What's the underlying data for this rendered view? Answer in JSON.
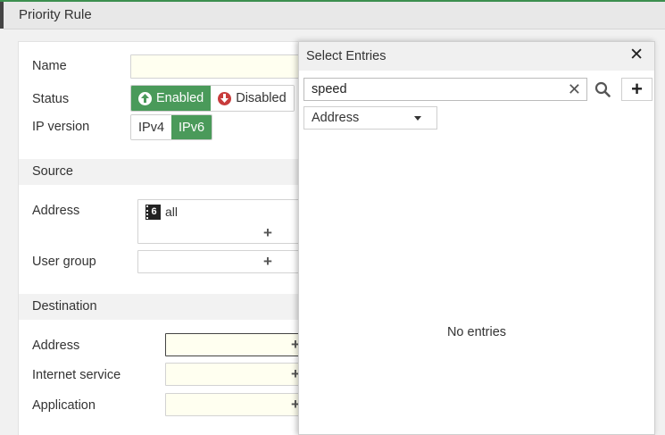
{
  "header": {
    "title": "Priority Rule"
  },
  "form": {
    "name_label": "Name",
    "name_value": "",
    "status_label": "Status",
    "status_options": [
      "Enabled",
      "Disabled"
    ],
    "status_selected": "Enabled",
    "ip_version_label": "IP version",
    "ip_options": [
      "IPv4",
      "IPv6"
    ],
    "ip_selected": "IPv6",
    "source": {
      "section_title": "Source",
      "address_label": "Address",
      "address_items": [
        "all"
      ],
      "user_group_label": "User group"
    },
    "destination": {
      "section_title": "Destination",
      "address_label": "Address",
      "internet_service_label": "Internet service",
      "application_label": "Application"
    },
    "add_symbol": "+"
  },
  "panel": {
    "title": "Select Entries",
    "close_symbol": "✕",
    "search_value": "speed",
    "clear_symbol": "✕",
    "add_symbol": "+",
    "filter_selected": "Address",
    "empty_text": "No entries"
  },
  "colors": {
    "accent_green": "#4a9a5a",
    "disabled_red": "#c83c3c",
    "input_bg": "#fffff0"
  },
  "icons": {
    "enabled": "arrow-up-circle-icon",
    "disabled": "arrow-down-circle-icon",
    "address_v6": "ipv6-address-icon",
    "search": "search-icon",
    "close": "close-icon"
  }
}
